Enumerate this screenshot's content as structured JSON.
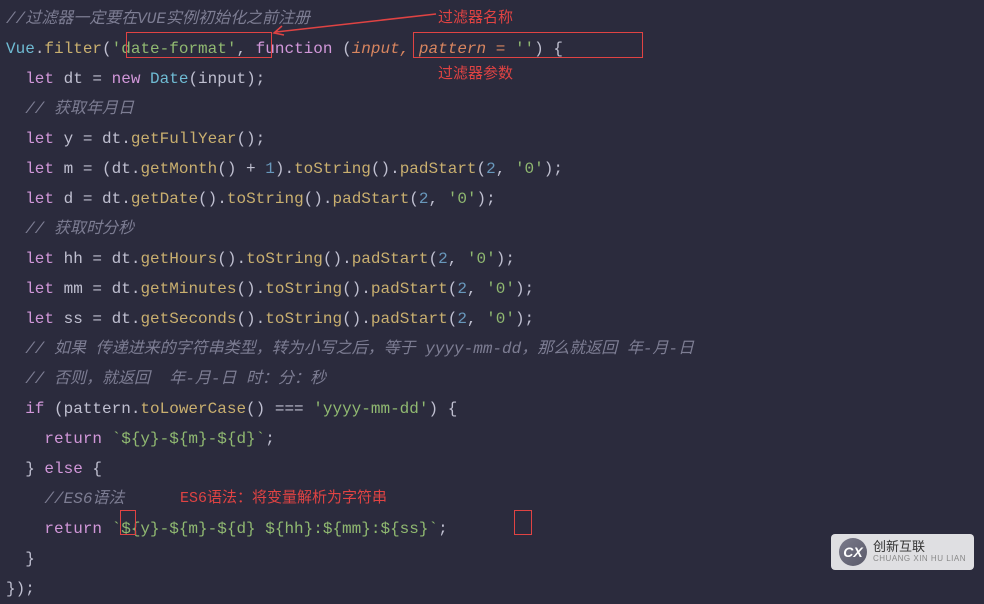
{
  "annotations": {
    "filter_name_label": "过滤器名称",
    "filter_param_label": "过滤器参数",
    "es6_label": "ES6语法：将变量解析为字符串"
  },
  "code": {
    "l1_comment": "//过滤器一定要在VUE实例初始化之前注册",
    "l2_vue": "Vue",
    "l2_filter": "filter",
    "l2_string": "'date-format'",
    "l2_function": "function",
    "l2_p1": "input",
    "l2_p2": "pattern",
    "l2_eq": " = ",
    "l2_empty": "''",
    "l3_let": "let",
    "l3_dt": " dt = ",
    "l3_new": "new",
    "l3_date": " Date",
    "l3_input": "(input);",
    "l4_comment": "// 获取年月日",
    "l5_let": "let",
    "l5_rest": " y = dt.",
    "l5_fn": "getFullYear",
    "l5_end": "();",
    "l6_let": "let",
    "l6_a": " m = (dt.",
    "l6_fn1": "getMonth",
    "l6_b": "() + ",
    "l6_one": "1",
    "l6_c": ").",
    "l6_fn2": "toString",
    "l6_d": "().",
    "l6_fn3": "padStart",
    "l6_e": "(",
    "l6_two": "2",
    "l6_f": ", ",
    "l6_zero": "'0'",
    "l6_g": ");",
    "l7_let": "let",
    "l7_a": " d = dt.",
    "l7_fn1": "getDate",
    "l7_b": "().",
    "l7_fn2": "toString",
    "l7_c": "().",
    "l7_fn3": "padStart",
    "l7_d": "(",
    "l7_two": "2",
    "l7_e": ", ",
    "l7_zero": "'0'",
    "l7_f": ");",
    "l8_comment": "// 获取时分秒",
    "l9_let": "let",
    "l9_a": " hh = dt.",
    "l9_fn1": "getHours",
    "l9_b": "().",
    "l9_fn2": "toString",
    "l9_c": "().",
    "l9_fn3": "padStart",
    "l9_d": "(",
    "l9_two": "2",
    "l9_e": ", ",
    "l9_zero": "'0'",
    "l9_f": ");",
    "l10_let": "let",
    "l10_a": " mm = dt.",
    "l10_fn1": "getMinutes",
    "l10_b": "().",
    "l10_fn2": "toString",
    "l10_c": "().",
    "l10_fn3": "padStart",
    "l10_d": "(",
    "l10_two": "2",
    "l10_e": ", ",
    "l10_zero": "'0'",
    "l10_f": ");",
    "l11_let": "let",
    "l11_a": " ss = dt.",
    "l11_fn1": "getSeconds",
    "l11_b": "().",
    "l11_fn2": "toString",
    "l11_c": "().",
    "l11_fn3": "padStart",
    "l11_d": "(",
    "l11_two": "2",
    "l11_e": ", ",
    "l11_zero": "'0'",
    "l11_f": ");",
    "l12_comment": "// 如果 传递进来的字符串类型，转为小写之后，等于 yyyy-mm-dd，那么就返回 年-月-日",
    "l13_comment": "// 否则，就返回  年-月-日 时：分：秒",
    "l14_if": "if",
    "l14_a": " (pattern.",
    "l14_fn": "toLowerCase",
    "l14_b": "() === ",
    "l14_str": "'yyyy-mm-dd'",
    "l14_c": ") {",
    "l15_return": "return",
    "l15_tmpl": " `${y}-${m}-${d}`",
    "l15_end": ";",
    "l16_a": "} ",
    "l16_else": "else",
    "l16_b": " {",
    "l17_comment": "//ES6语法",
    "l18_return": "return",
    "l18_tmpl": " `${y}-${m}-${d} ${hh}:${mm}:${ss}`",
    "l18_end": ";",
    "l19": "}",
    "l20": "});"
  },
  "watermark": {
    "logo": "CX",
    "cn": "创新互联",
    "en": "CHUANG XIN HU LIAN"
  }
}
